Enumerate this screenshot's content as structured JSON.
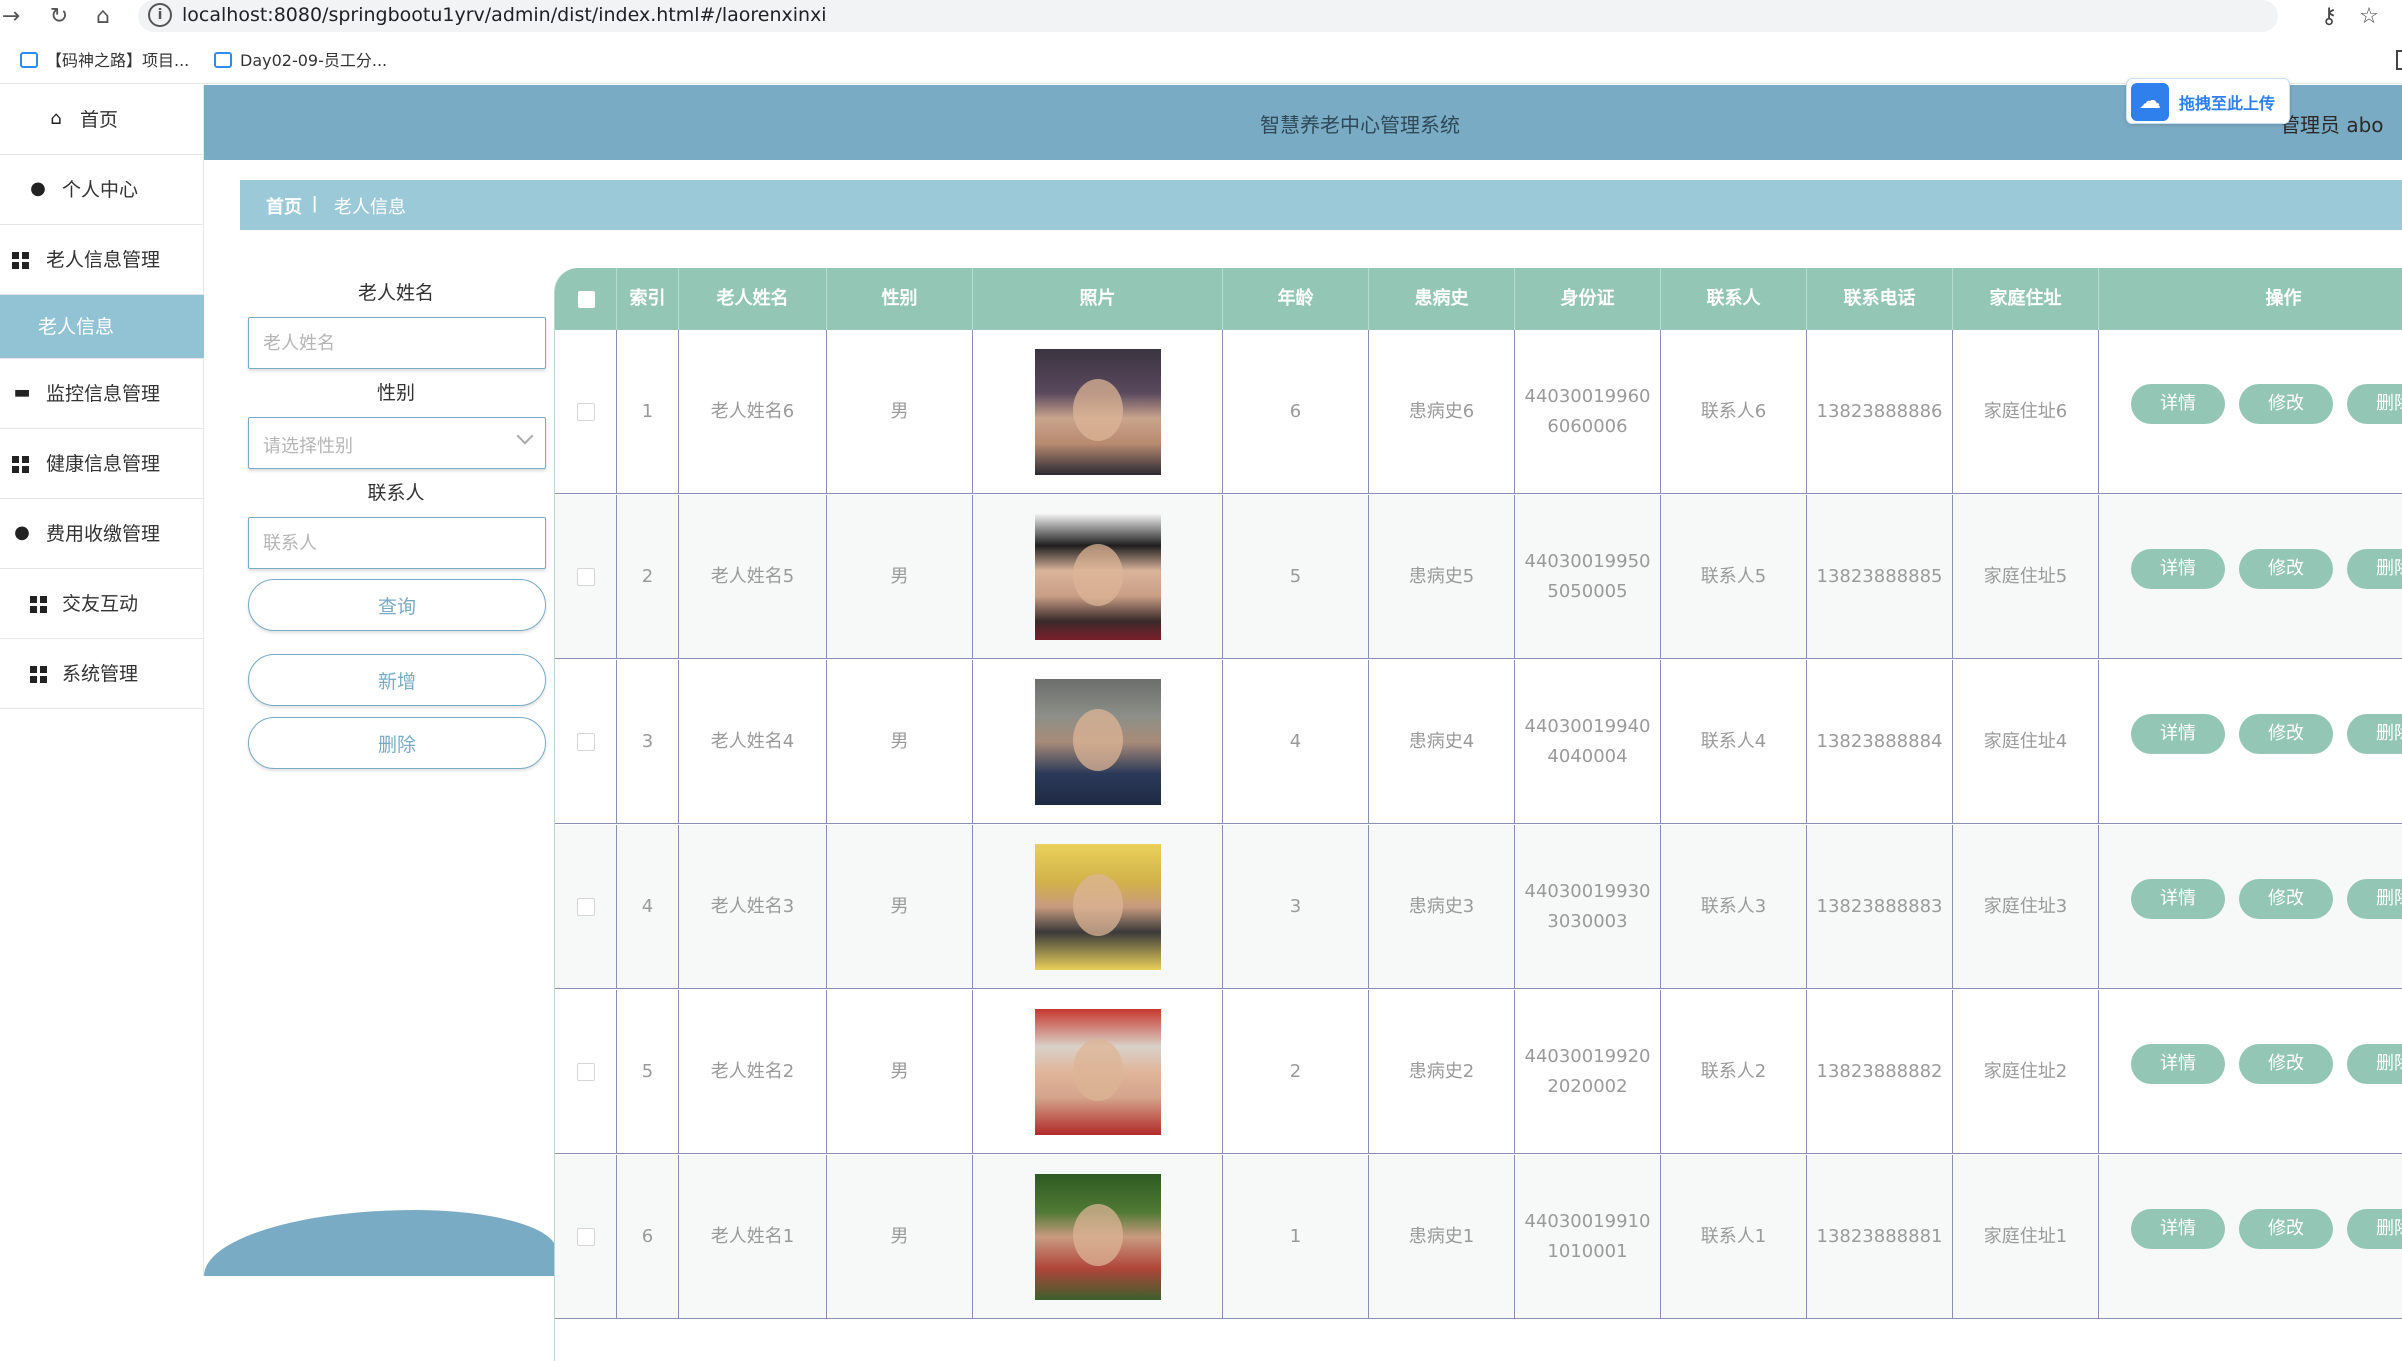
{
  "browser": {
    "url": "localhost:8080/springbootu1yrv/admin/dist/index.html#/laorenxinxi",
    "bookmarks": [
      "【码神之路】项目...",
      "Day02-09-员工分..."
    ]
  },
  "header": {
    "title": "智慧养老中心管理系统",
    "user": "管理员 abo",
    "upload_badge": "拖拽至此上传"
  },
  "sidebar": {
    "items": [
      {
        "label": "首页",
        "icon": "home-icon"
      },
      {
        "label": "个人中心",
        "icon": "user-icon"
      },
      {
        "label": "老人信息管理",
        "icon": "grid-icon"
      },
      {
        "label": "老人信息",
        "icon": ""
      },
      {
        "label": "监控信息管理",
        "icon": "monitor-icon"
      },
      {
        "label": "健康信息管理",
        "icon": "grid-icon"
      },
      {
        "label": "费用收缴管理",
        "icon": "lightbulb-icon"
      },
      {
        "label": "交友互动",
        "icon": "grid-icon"
      },
      {
        "label": "系统管理",
        "icon": "grid-icon"
      }
    ]
  },
  "breadcrumb": {
    "home": "首页",
    "separator": "ǀ",
    "current": "老人信息"
  },
  "filters": {
    "name_label": "老人姓名",
    "name_placeholder": "老人姓名",
    "gender_label": "性别",
    "gender_placeholder": "请选择性别",
    "contact_label": "联系人",
    "contact_placeholder": "联系人",
    "query_button": "查询",
    "add_button": "新增",
    "delete_button": "删除"
  },
  "table": {
    "columns": [
      "索引",
      "老人姓名",
      "性别",
      "照片",
      "年龄",
      "患病史",
      "身份证",
      "联系人",
      "联系电话",
      "家庭住址",
      "操作"
    ],
    "actions": {
      "detail": "详情",
      "edit": "修改",
      "delete": "删除"
    },
    "rows": [
      {
        "index": "1",
        "name": "老人姓名6",
        "gender": "男",
        "age": "6",
        "history": "患病史6",
        "id_line1": "44030019960",
        "id_line2": "6060006",
        "contact": "联系人6",
        "phone": "13823888886",
        "address": "家庭住址6"
      },
      {
        "index": "2",
        "name": "老人姓名5",
        "gender": "男",
        "age": "5",
        "history": "患病史5",
        "id_line1": "44030019950",
        "id_line2": "5050005",
        "contact": "联系人5",
        "phone": "13823888885",
        "address": "家庭住址5"
      },
      {
        "index": "3",
        "name": "老人姓名4",
        "gender": "男",
        "age": "4",
        "history": "患病史4",
        "id_line1": "44030019940",
        "id_line2": "4040004",
        "contact": "联系人4",
        "phone": "13823888884",
        "address": "家庭住址4"
      },
      {
        "index": "4",
        "name": "老人姓名3",
        "gender": "男",
        "age": "3",
        "history": "患病史3",
        "id_line1": "44030019930",
        "id_line2": "3030003",
        "contact": "联系人3",
        "phone": "13823888883",
        "address": "家庭住址3"
      },
      {
        "index": "5",
        "name": "老人姓名2",
        "gender": "男",
        "age": "2",
        "history": "患病史2",
        "id_line1": "44030019920",
        "id_line2": "2020002",
        "contact": "联系人2",
        "phone": "13823888882",
        "address": "家庭住址2"
      },
      {
        "index": "6",
        "name": "老人姓名1",
        "gender": "男",
        "age": "1",
        "history": "患病史1",
        "id_line1": "44030019910",
        "id_line2": "1010001",
        "contact": "联系人1",
        "phone": "13823888881",
        "address": "家庭住址1"
      }
    ]
  },
  "colors": {
    "header": "#7aabc4",
    "breadcrumb": "#9bc9d8",
    "table_header": "#93c6b4",
    "active_menu": "#91c3d4"
  }
}
